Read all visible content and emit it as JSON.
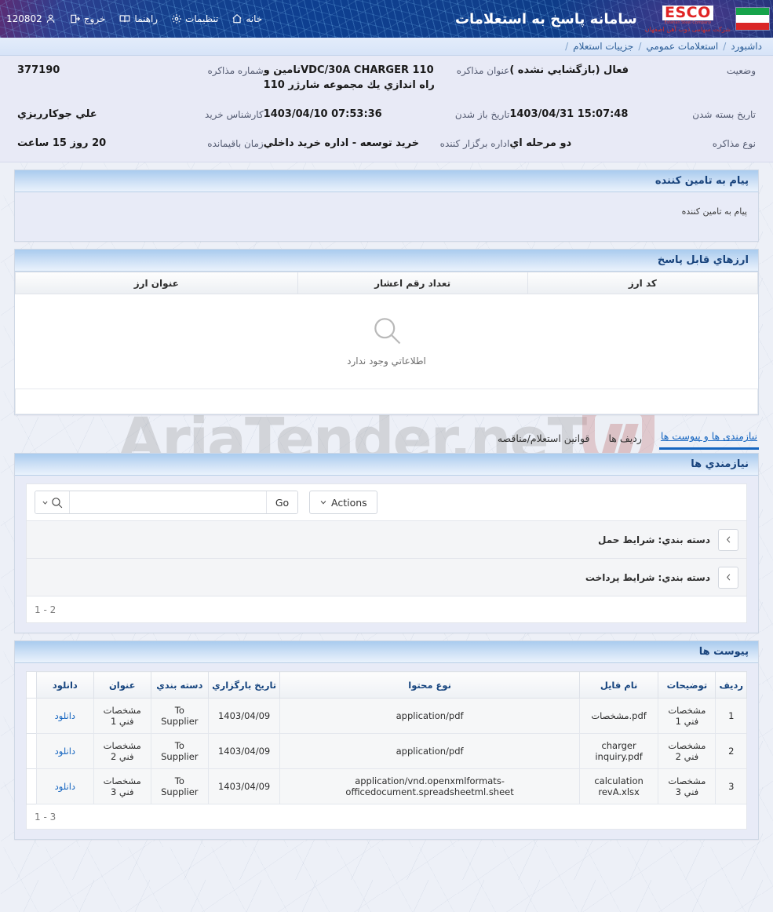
{
  "header": {
    "app_title": "سامانه پاسخ به استعلامات",
    "logo_primary": "ESCO",
    "logo_sub": "Esfahan Steel Company",
    "logo_fa": "شرکت سهامی ذوب آهن اصفهان",
    "nav": [
      {
        "label": "خانه",
        "icon": "home-icon"
      },
      {
        "label": "تنظیمات",
        "icon": "gear-icon"
      },
      {
        "label": "راهنما",
        "icon": "book-icon"
      },
      {
        "label": "خروج",
        "icon": "logout-icon"
      },
      {
        "label": "120802",
        "icon": "user-icon"
      }
    ]
  },
  "breadcrumb": {
    "items": [
      "داشبورد",
      "استعلامات عمومي",
      "جزییات استعلام"
    ],
    "separator": "/"
  },
  "info": {
    "fields": [
      {
        "label": "شماره مذاکره",
        "value": "377190",
        "ltr": false
      },
      {
        "label": "عنوان مذاکره",
        "value": "110 VDC/30A CHARGERتامین و راه اندازي يك مجموعه شارژر 110",
        "ltr": false
      },
      {
        "label": "وضعیت",
        "value": "فعال (بازگشایي نشده )",
        "ltr": false
      },
      {
        "label": "کارشناس خرید",
        "value": "علي جوکارريزي",
        "ltr": false
      },
      {
        "label": "تاریخ باز شدن",
        "value": "07:53:36 1403/04/10",
        "ltr": false
      },
      {
        "label": "تاریخ بسته شدن",
        "value": "1403/04/31 15:07:48",
        "ltr": true
      },
      {
        "label": "زمان باقیمانده",
        "value": "20 روز 15 ساعت",
        "ltr": false
      },
      {
        "label": "اداره برگزار کننده",
        "value": "خرید توسعه - اداره خرید داخلي",
        "ltr": false
      },
      {
        "label": "نوع مذاکره",
        "value": "دو مرحله اي",
        "ltr": false
      }
    ]
  },
  "supplier_message": {
    "title": "پیام به تامین کننده",
    "body": "پیام به تامین کننده"
  },
  "currencies": {
    "title": "ارزهاي قابل پاسخ",
    "columns": [
      "کد ارز",
      "تعداد رقم اعشار",
      "عنوان ارز"
    ],
    "rows": [],
    "empty_text": "اطلاعاتي وجود ندارد",
    "empty_icon": "magnifier-icon"
  },
  "tabs": [
    {
      "label": "نیازمندی ها و پیوست ها",
      "active": true
    },
    {
      "label": "ردیف ها",
      "active": false
    },
    {
      "label": "قوانین استعلام/مناقصه",
      "active": false
    }
  ],
  "requirements": {
    "title": "نیازمندي ها",
    "search_value": "",
    "search_placeholder": "",
    "go_label": "Go",
    "actions_label": "Actions",
    "groups": [
      {
        "title": "دسته بندي: شرایط حمل"
      },
      {
        "title": "دسته بندي: شرایط پرداخت"
      }
    ],
    "pager": "1 - 2"
  },
  "attachments": {
    "title": "پیوست ها",
    "columns": [
      "ردیف",
      "توضیحات",
      "نام فایل",
      "نوع محتوا",
      "تاریخ بارگزاري",
      "دسته بندي",
      "عنوان",
      "دانلود"
    ],
    "rows": [
      {
        "index": "1",
        "description": "مشخصات فني 1",
        "filename": "مشخصات.pdf",
        "content_type": "application/pdf",
        "upload_date": "1403/04/09",
        "category": "To Supplier",
        "title": "مشخصات فني 1",
        "download": "دانلود"
      },
      {
        "index": "2",
        "description": "مشخصات فني 2",
        "filename": "charger inquiry.pdf",
        "content_type": "application/pdf",
        "upload_date": "1403/04/09",
        "category": "To Supplier",
        "title": "مشخصات فني 2",
        "download": "دانلود"
      },
      {
        "index": "3",
        "description": "مشخصات فني 3",
        "filename": "calculation revA.xlsx",
        "content_type": "application/vnd.openxmlformats-officedocument.spreadsheetml.sheet",
        "upload_date": "1403/04/09",
        "category": "To Supplier",
        "title": "مشخصات فني 3",
        "download": "دانلود"
      }
    ],
    "pager": "1 - 3"
  },
  "watermark": {
    "text": "AriaTender.neT"
  },
  "colors": {
    "banner": "#0e3f90",
    "accent": "#1565c0",
    "panel": "#e8eaf6",
    "heading": "#18437c"
  }
}
